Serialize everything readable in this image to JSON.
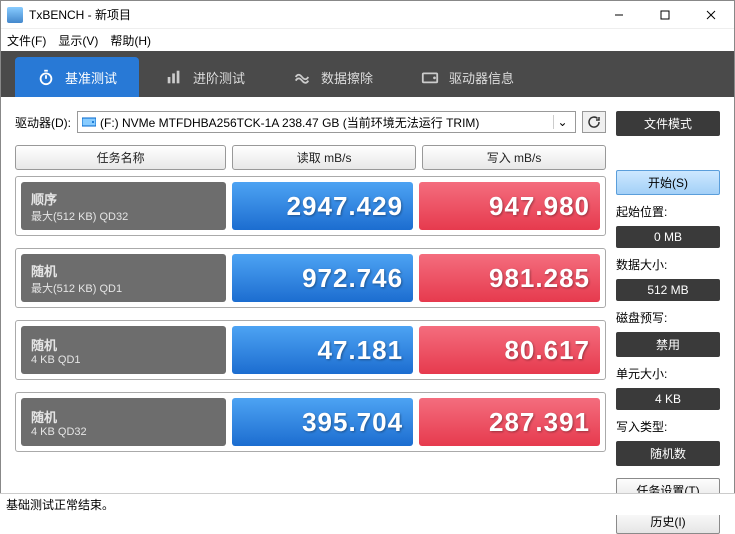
{
  "window": {
    "title": "TxBENCH - 新项目"
  },
  "menu": {
    "file": "文件(F)",
    "view": "显示(V)",
    "help": "帮助(H)"
  },
  "tabs": {
    "bench": "基准测试",
    "advanced": "进阶测试",
    "erase": "数据擦除",
    "driveinfo": "驱动器信息"
  },
  "drive": {
    "label": "驱动器(D):",
    "value": "(F:) NVMe MTFDHBA256TCK-1A  238.47 GB (当前环境无法运行 TRIM)"
  },
  "filemode_btn": "文件模式",
  "headers": {
    "name": "任务名称",
    "read": "读取 mB/s",
    "write": "写入 mB/s"
  },
  "rows": [
    {
      "title": "顺序",
      "sub": "最大(512 KB) QD32",
      "read": "2947.429",
      "write": "947.980"
    },
    {
      "title": "随机",
      "sub": "最大(512 KB) QD1",
      "read": "972.746",
      "write": "981.285"
    },
    {
      "title": "随机",
      "sub": "4 KB QD1",
      "read": "47.181",
      "write": "80.617"
    },
    {
      "title": "随机",
      "sub": "4 KB QD32",
      "read": "395.704",
      "write": "287.391"
    }
  ],
  "side": {
    "start": "开始(S)",
    "startpos_label": "起始位置:",
    "startpos_val": "0 MB",
    "datasize_label": "数据大小:",
    "datasize_val": "512 MB",
    "prefetch_label": "磁盘预写:",
    "prefetch_val": "禁用",
    "unitsize_label": "单元大小:",
    "unitsize_val": "4 KB",
    "writetype_label": "写入类型:",
    "writetype_val": "随机数",
    "tasksettings": "任务设置(T)",
    "history": "历史(I)"
  },
  "status": "基础测试正常结束。"
}
